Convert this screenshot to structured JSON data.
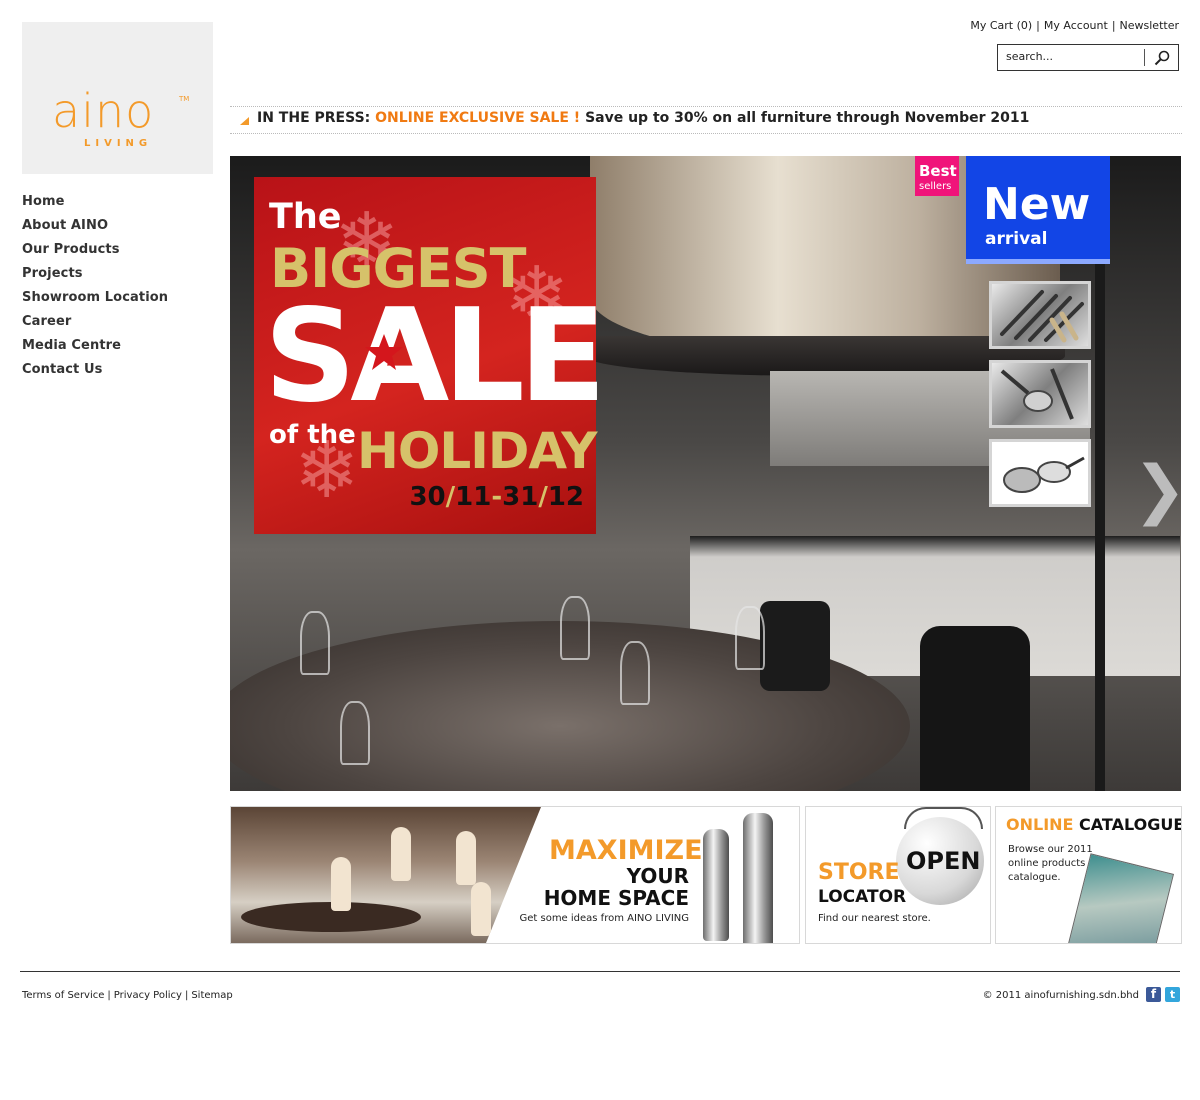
{
  "brand": {
    "logo_text": "aino",
    "logo_tm": "TM",
    "logo_sub": "LIVING"
  },
  "nav": {
    "items": [
      {
        "label": "Home"
      },
      {
        "label": "About AINO"
      },
      {
        "label": "Our Products"
      },
      {
        "label": "Projects"
      },
      {
        "label": "Showroom Location"
      },
      {
        "label": "Career"
      },
      {
        "label": "Media Centre"
      },
      {
        "label": "Contact Us"
      }
    ]
  },
  "header": {
    "links": {
      "cart": "My Cart (0)",
      "account": "My Account",
      "newsletter": "Newsletter",
      "sep": "|"
    },
    "search": {
      "placeholder": "search...",
      "value": "search..."
    }
  },
  "press": {
    "lead": "IN THE PRESS:",
    "highlight": "ONLINE EXCLUSIVE SALE !",
    "text": "Save up to 30% on all furniture through November 2011"
  },
  "hero": {
    "sale": {
      "the": "The",
      "biggest": "BIGGEST",
      "sale": "SALE",
      "of_the": "of the",
      "holiday": "HOLIDAY",
      "date_a": "30",
      "date_b": "11",
      "date_dash": "-",
      "date_c": "31",
      "date_d": "12",
      "slash": "/"
    },
    "best_sellers": {
      "line1": "Best",
      "line2": "sellers"
    },
    "new_arrival": {
      "line1": "New",
      "line2": "arrival"
    },
    "next_arrow": "❯"
  },
  "promos": {
    "maximize": {
      "line1": "MAXIMIZE",
      "line2": "YOUR",
      "line3": "HOME SPACE",
      "sub": "Get some ideas from AINO LIVING"
    },
    "store": {
      "sign": "OPEN",
      "line1": "STORE",
      "line2": "LOCATOR",
      "sub": "Find our nearest store."
    },
    "catalogue": {
      "title_a": "ONLINE",
      "title_b": "CATALOGUE",
      "desc": "Browse our 2011 online products catalogue."
    }
  },
  "footer": {
    "links": [
      "Terms of Service",
      "Privacy Policy",
      "Sitemap"
    ],
    "sep": "|",
    "copyright": "© 2011 ainofurnishing.sdn.bhd",
    "social": {
      "facebook": "f",
      "twitter": "t"
    }
  },
  "colors": {
    "accent": "#f39a2a",
    "sale_red": "#c41a1c",
    "gold": "#d6c26a",
    "new_blue": "#1245e6",
    "best_pink": "#f0147a"
  }
}
